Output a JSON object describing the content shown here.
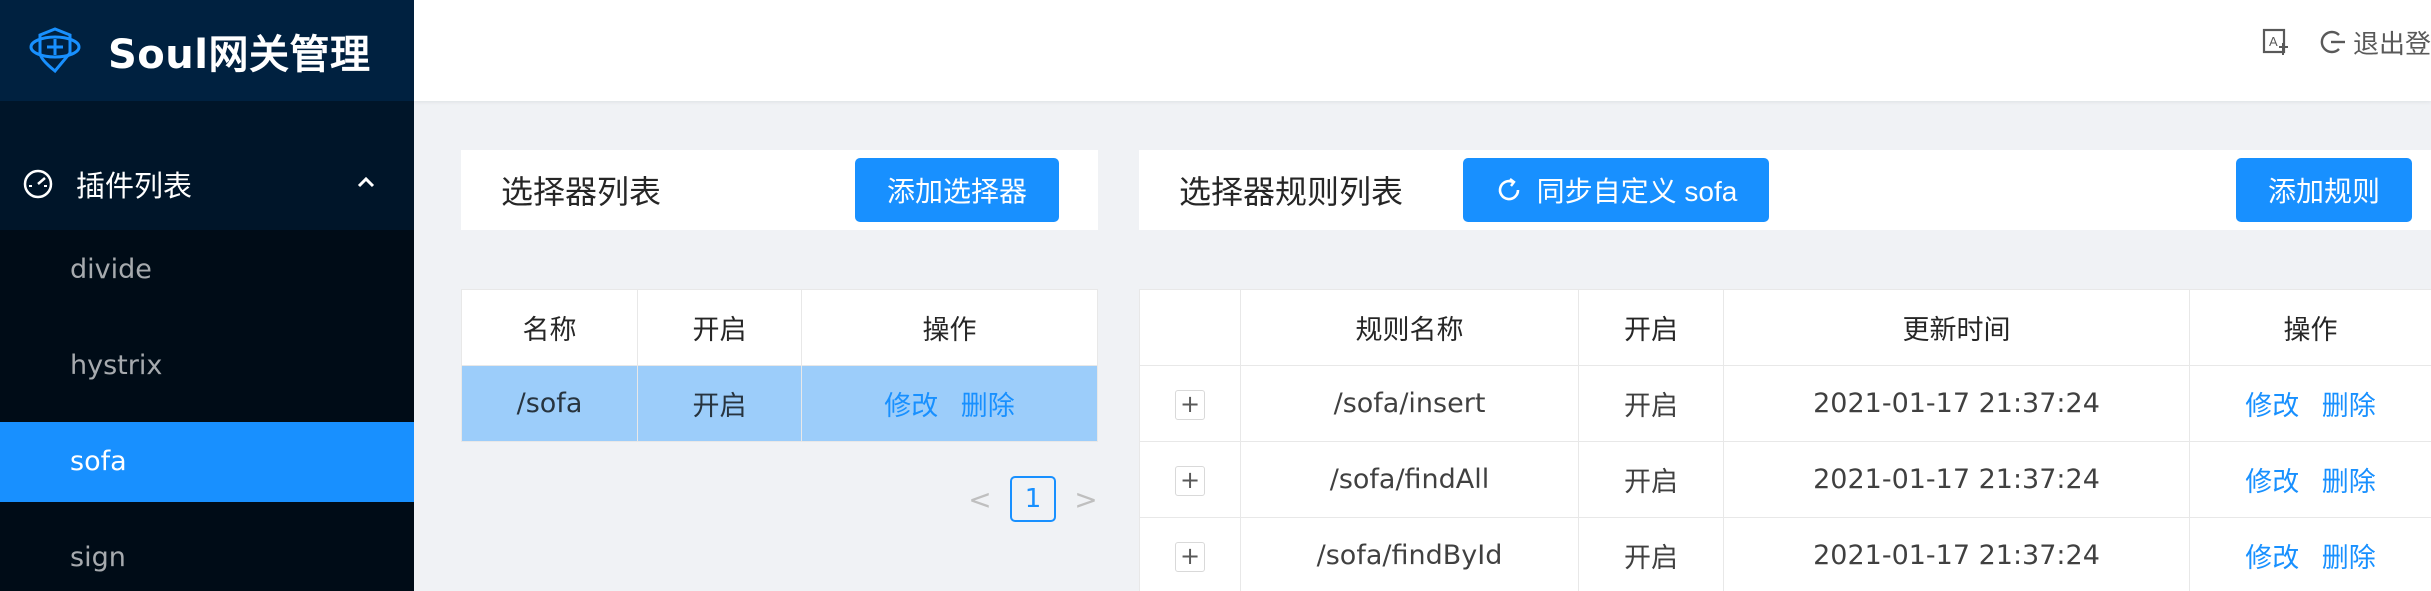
{
  "app": {
    "title": "Soul网关管理"
  },
  "sidebar": {
    "menu_label": "插件列表",
    "items": [
      {
        "label": "divide"
      },
      {
        "label": "hystrix"
      },
      {
        "label": "sofa"
      },
      {
        "label": "sign"
      }
    ]
  },
  "header": {
    "logout_label": "退出登"
  },
  "selector_panel": {
    "title": "选择器列表",
    "add_button": "添加选择器",
    "columns": [
      "名称",
      "开启",
      "操作"
    ],
    "rows": [
      {
        "name": "/sofa",
        "enabled": "开启",
        "edit": "修改",
        "delete": "删除"
      }
    ],
    "pagination": {
      "current": "1",
      "prev": "<",
      "next": ">"
    }
  },
  "rule_panel": {
    "title": "选择器规则列表",
    "sync_button": "同步自定义 sofa",
    "add_button": "添加规则",
    "columns": [
      "",
      "规则名称",
      "开启",
      "更新时间",
      "操作"
    ],
    "rows": [
      {
        "expand": "+",
        "name": "/sofa/insert",
        "enabled": "开启",
        "updated": "2021-01-17 21:37:24",
        "edit": "修改",
        "delete": "删除"
      },
      {
        "expand": "+",
        "name": "/sofa/findAll",
        "enabled": "开启",
        "updated": "2021-01-17 21:37:24",
        "edit": "修改",
        "delete": "删除"
      },
      {
        "expand": "+",
        "name": "/sofa/findById",
        "enabled": "开启",
        "updated": "2021-01-17 21:37:24",
        "edit": "修改",
        "delete": "删除"
      }
    ]
  },
  "colors": {
    "primary": "#1890ff",
    "sidebar_bg": "#001529",
    "enabled_green": "#52c41a",
    "selected_row": "#9ccdfa"
  }
}
